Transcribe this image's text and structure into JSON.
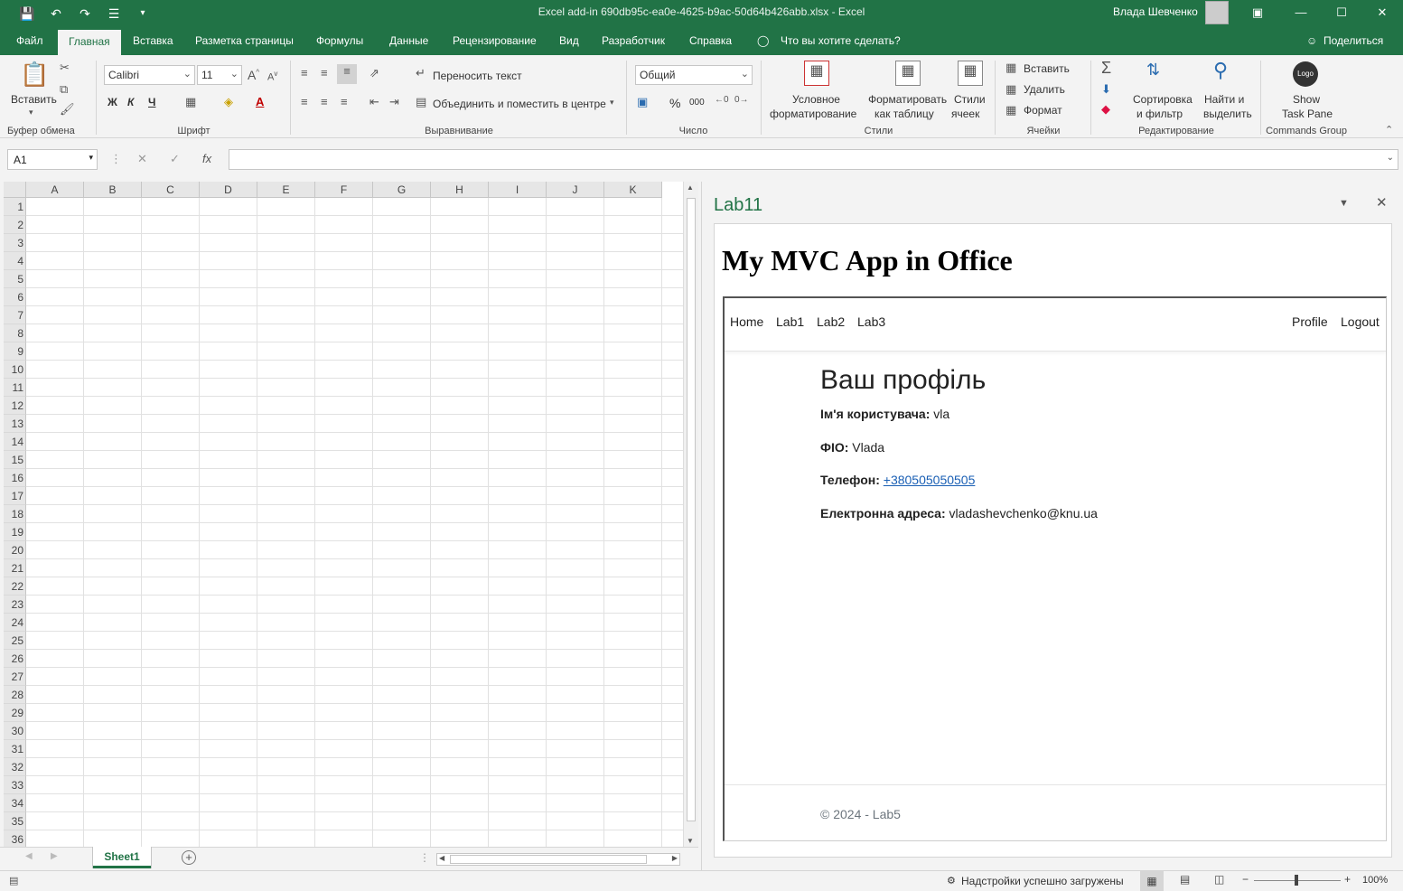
{
  "window": {
    "title": "Excel add-in 690db95c-ea0e-4625-b9ac-50d64b426abb.xlsx  -  Excel",
    "user": "Влада Шевченко"
  },
  "ribbon_tabs": [
    "Файл",
    "Главная",
    "Вставка",
    "Разметка страницы",
    "Формулы",
    "Данные",
    "Рецензирование",
    "Вид",
    "Разработчик",
    "Справка",
    "Что вы хотите сделать?"
  ],
  "share_label": "Поделиться",
  "ribbon": {
    "paste_label": "Вставить",
    "clipboard_group": "Буфер обмена",
    "font_name": "Calibri",
    "font_size": "11",
    "font_group": "Шрифт",
    "bold": "Ж",
    "italic": "К",
    "underline": "Ч",
    "wrap_text": "Переносить текст",
    "merge_center": "Объединить и поместить в центре",
    "alignment_group": "Выравнивание",
    "number_format": "Общий",
    "percent": "%",
    "thousands": "000",
    "number_group": "Число",
    "conditional_format_1": "Условное",
    "conditional_format_2": "форматирование",
    "format_table_1": "Форматировать",
    "format_table_2": "как таблицу",
    "cell_styles_1": "Стили",
    "cell_styles_2": "ячеек",
    "styles_group": "Стили",
    "insert_cells": "Вставить",
    "delete_cells": "Удалить",
    "format_cells": "Формат",
    "cells_group": "Ячейки",
    "sort_filter_1": "Сортировка",
    "sort_filter_2": "и фильтр",
    "find_select_1": "Найти и",
    "find_select_2": "выделить",
    "editing_group": "Редактирование",
    "logo_text": "Logo",
    "show_taskpane_1": "Show",
    "show_taskpane_2": "Task Pane",
    "commands_group": "Commands Group"
  },
  "formula_bar": {
    "name_box": "A1",
    "fx": "fx",
    "value": ""
  },
  "grid": {
    "columns": [
      "A",
      "B",
      "C",
      "D",
      "E",
      "F",
      "G",
      "H",
      "I",
      "J",
      "K"
    ],
    "rows": [
      "1",
      "2",
      "3",
      "4",
      "5",
      "6",
      "7",
      "8",
      "9",
      "10",
      "11",
      "12",
      "13",
      "14",
      "15",
      "16",
      "17",
      "18",
      "19",
      "20",
      "21",
      "22",
      "23",
      "24",
      "25",
      "26",
      "27",
      "28",
      "29",
      "30",
      "31",
      "32",
      "33",
      "34",
      "35",
      "36"
    ]
  },
  "sheet_tab": "Sheet1",
  "status": {
    "message": "Надстройки успешно загружены",
    "zoom": "100%"
  },
  "taskpane": {
    "title": "Lab11",
    "app_title": "My MVC App in Office",
    "nav": {
      "home": "Home",
      "lab1": "Lab1",
      "lab2": "Lab2",
      "lab3": "Lab3",
      "profile": "Profile",
      "logout": "Logout"
    },
    "profile": {
      "heading": "Ваш профіль",
      "username_label": "Ім'я користувача:",
      "username_value": "vla",
      "fio_label": "ФІО:",
      "fio_value": "Vlada",
      "phone_label": "Телефон:",
      "phone_value": "+380505050505",
      "email_label": "Електронна адреса:",
      "email_value": "vladashevchenko@knu.ua"
    },
    "footer": "© 2024 - Lab5"
  },
  "colors": {
    "excel_green": "#217346",
    "link_blue": "#1a5fb4"
  }
}
